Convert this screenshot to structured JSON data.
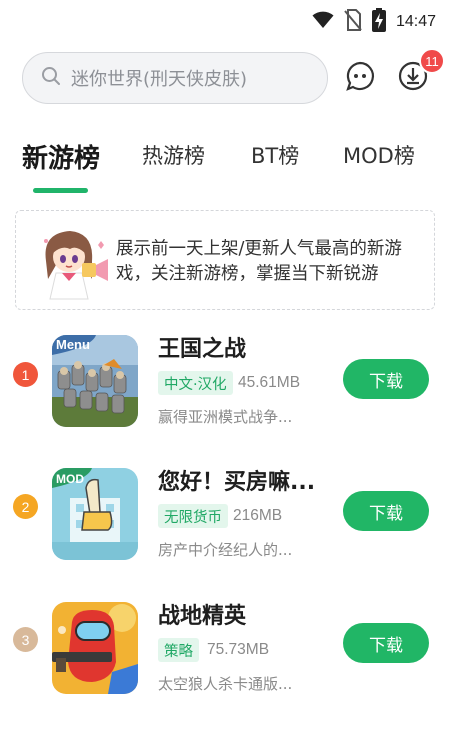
{
  "status_bar": {
    "time": "14:47",
    "icons": [
      "wifi-icon",
      "no-sim-icon",
      "battery-charging-icon"
    ]
  },
  "search": {
    "placeholder": "迷你世界(刑天侠皮肤)",
    "icon": "search-icon"
  },
  "header_actions": {
    "chat_icon": "chat-bubble-icon",
    "download_icon": "download-icon",
    "download_badge": "11"
  },
  "tabs": [
    {
      "label": "新游榜",
      "active": true
    },
    {
      "label": "热游榜",
      "active": false
    },
    {
      "label": "BT榜",
      "active": false
    },
    {
      "label": "MOD榜",
      "active": false
    }
  ],
  "banner": {
    "text": "展示前一天上架/更新人气最高的新游戏，关注新游榜，掌握当下新锐游",
    "mascot": "anime-girl-mascot"
  },
  "apps": [
    {
      "rank": "1",
      "rank_color": "#f0563b",
      "name": "王国之战",
      "tag": "中文·汉化",
      "size": "45.61MB",
      "desc": "赢得亚洲模式战争...",
      "button": "下载",
      "icon_label": "Menu"
    },
    {
      "rank": "2",
      "rank_color": "#f5a623",
      "name": "您好！买房嘛...",
      "tag": "无限货币",
      "size": "216MB",
      "desc": "房产中介经纪人的...",
      "button": "下载",
      "icon_label": "MOD"
    },
    {
      "rank": "3",
      "rank_color": "#d8b99a",
      "name": "战地精英",
      "tag": "策略",
      "size": "75.73MB",
      "desc": "太空狼人杀卡通版...",
      "button": "下载"
    }
  ],
  "colors": {
    "accent": "#21b666",
    "badge": "#f04a4a",
    "tag_bg": "#e3f6ec"
  }
}
